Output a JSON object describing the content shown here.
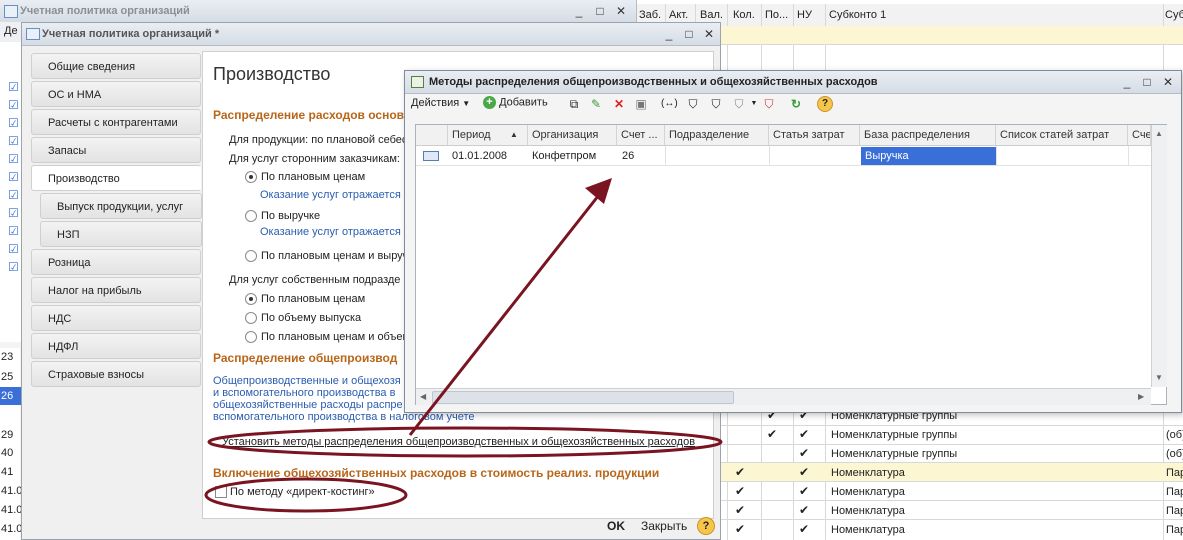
{
  "bg_window": {
    "title": "Учетная политика организаций",
    "partial_label": "Де"
  },
  "right_table": {
    "headers": [
      "Заб.",
      "Акт.",
      "Вал.",
      "Кол.",
      "По...",
      "НУ",
      "Субконто 1",
      "Суб"
    ],
    "rows": [
      {
        "num": "",
        "kol": "",
        "po": "✔",
        "nu": "✔",
        "sub1": "Номенклатурные группы",
        "sub2": ""
      },
      {
        "num": "",
        "kol": "",
        "po": "✔",
        "nu": "✔",
        "sub1": "Номенклатурные группы",
        "sub2": "(об)"
      },
      {
        "num": "",
        "kol": "",
        "po": "",
        "nu": "✔",
        "sub1": "Номенклатурные группы",
        "sub2": "(об)"
      },
      {
        "num": "",
        "kol": "✔",
        "po": "",
        "nu": "✔",
        "sub1": "Номенклатура",
        "sub2": "Пар"
      },
      {
        "num": "",
        "kol": "✔",
        "po": "",
        "nu": "✔",
        "sub1": "Номенклатура",
        "sub2": "Пар"
      },
      {
        "num": "",
        "kol": "✔",
        "po": "",
        "nu": "✔",
        "sub1": "Номенклатура",
        "sub2": "Пар"
      },
      {
        "num": "",
        "kol": "✔",
        "po": "",
        "nu": "✔",
        "sub1": "Номенклатура",
        "sub2": "Пар"
      }
    ],
    "left_numbers": [
      "23",
      "25",
      "26",
      "29",
      "40",
      "41",
      "41.0",
      "41.0",
      "41.0"
    ]
  },
  "policy_window": {
    "title": "Учетная политика организаций *",
    "nav": [
      "Общие сведения",
      "ОС и НМА",
      "Расчеты с контрагентами",
      "Запасы",
      "Производство",
      "Выпуск продукции, услуг",
      "НЗП",
      "Розница",
      "Налог на прибыль",
      "НДС",
      "НДФЛ",
      "Страховые взносы"
    ],
    "heading": "Производство",
    "section1": "Распределение расходов основн",
    "line_products": "Для продукции: по плановой себес",
    "line_third": "Для услуг сторонним заказчикам:",
    "opt_plan": "По плановым ценам",
    "note1": "Оказание услуг отражается",
    "opt_revenue": "По выручке",
    "note2": "Оказание услуг отражается",
    "opt_plan_rev": "По плановым ценам и выруч",
    "line_own": "Для услуг собственным подразде",
    "opt_plan2": "По плановым ценам",
    "opt_volume": "По объему выпуска",
    "opt_plan_vol": "По плановым ценам и объем",
    "section2": "Распределение общепроизвод",
    "desc1": "Общепроизводственные и общехозя",
    "desc2": "и вспомогательного производства в",
    "desc3": "общехозяйственные расходы распре",
    "desc4": "вспомогательного производства в налоговом учете",
    "link_methods": "Установить методы распределения общепроизводственных и общехозяйственных расходов",
    "section3": "Включение общехозяйственных расходов в стоимость реализ. продукции",
    "checkbox_direct": "По методу «директ-костинг»",
    "ok": "OK",
    "close": "Закрыть",
    "help": "?"
  },
  "methods_window": {
    "title": "Методы распределения общепроизводственных и общехозяйственных расходов",
    "toolbar": {
      "actions": "Действия",
      "add": "Добавить"
    },
    "columns": [
      "Период",
      "Организация",
      "Счет ...",
      "Подразделение",
      "Статья затрат",
      "База распределения",
      "Список статей затрат",
      "Сче"
    ],
    "rows": [
      {
        "period": "01.01.2008",
        "org": "Конфетпром",
        "account": "26",
        "division": "",
        "cost_item": "",
        "base": "Выручка",
        "items_list": "",
        "acc2": ""
      }
    ]
  },
  "colors": {
    "annotation": "#7a1420",
    "selection": "#3a6fd8",
    "highlight_row": "#fdf6d2"
  }
}
